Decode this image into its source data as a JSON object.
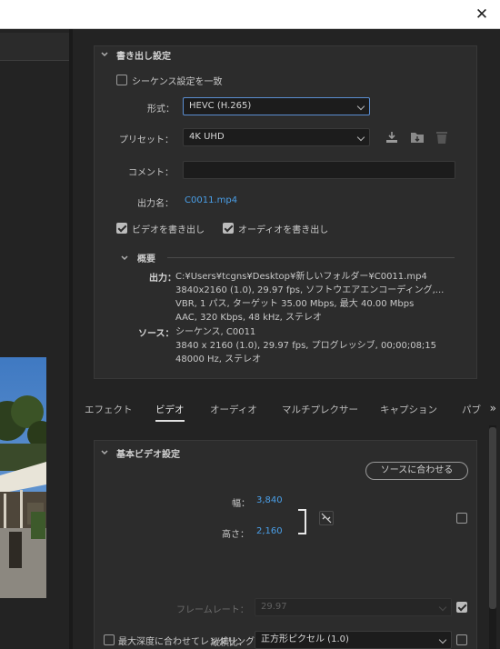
{
  "window": {
    "close_glyph": "✕"
  },
  "export": {
    "section_title": "書き出し設定",
    "match_sequence_label": "シーケンス設定を一致",
    "format_label": "形式：",
    "format_value": "HEVC (H.265)",
    "preset_label": "プリセット：",
    "preset_value": "4K UHD",
    "comment_label": "コメント：",
    "comment_value": "",
    "output_name_label": "出力名：",
    "output_name_value": "C0011.mp4",
    "export_video_label": "ビデオを書き出し",
    "export_audio_label": "オーディオを書き出し",
    "summary_title": "概要",
    "output_key": "出力：",
    "output_lines": [
      "C:¥Users¥tcgns¥Desktop¥新しいフォルダー¥C0011.mp4",
      "3840x2160 (1.0), 29.97 fps, ソフトウエアエンコーディング,...",
      "VBR, 1 パス, ターゲット 35.00 Mbps, 最大 40.00 Mbps",
      "AAC, 320 Kbps, 48 kHz, ステレオ"
    ],
    "source_key": "ソース：",
    "source_lines": [
      "シーケンス, C0011",
      "3840 x 2160 (1.0), 29.97 fps, プログレッシブ, 00;00;08;15",
      "48000 Hz, ステレオ"
    ]
  },
  "tabs": [
    "エフェクト",
    "ビデオ",
    "オーディオ",
    "マルチプレクサー",
    "キャプション",
    "パブ"
  ],
  "tabs_more": "»",
  "video": {
    "section_title": "基本ビデオ設定",
    "match_source_button": "ソースに合わせる",
    "width_label": "幅：",
    "width_value": "3,840",
    "height_label": "高さ：",
    "height_value": "2,160",
    "frame_rate_label": "フレームレート：",
    "frame_rate_value": "29.97",
    "aspect_label": "縦横比：",
    "aspect_value": "正方形ピクセル (1.0)",
    "max_depth_label": "最大深度に合わせてレンダリング"
  },
  "colors": {
    "accent_link": "#4a9fe8",
    "focus_border": "#5b8ed1",
    "panel_bg": "#2c2c2c"
  }
}
